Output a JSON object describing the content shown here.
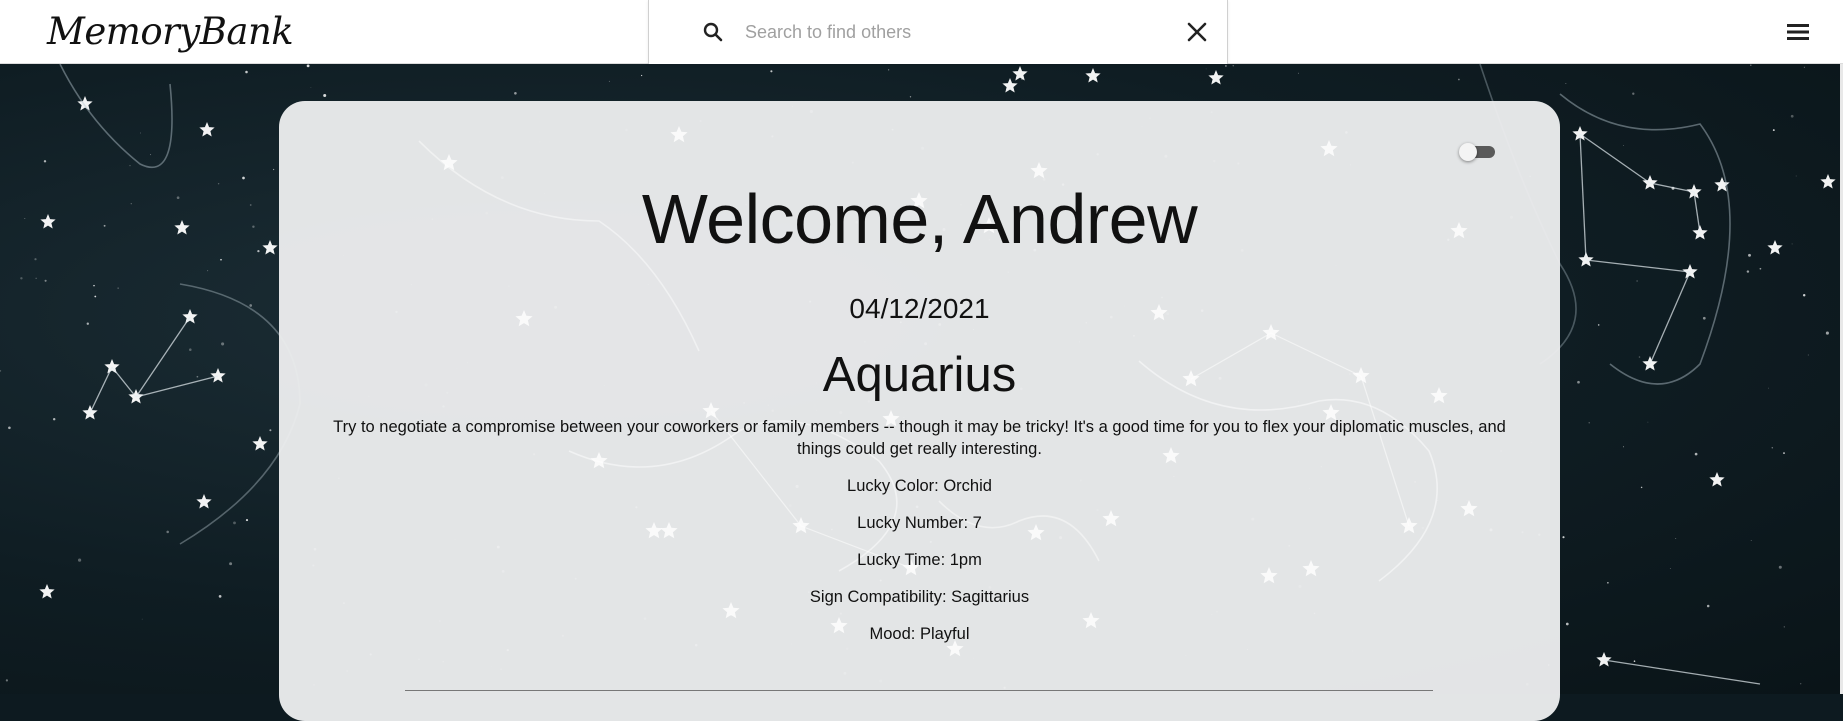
{
  "app": {
    "logo": "MemoryBank"
  },
  "search": {
    "placeholder": "Search to find others",
    "value": ""
  },
  "icons": {
    "search": "search-icon",
    "close": "close-icon",
    "menu": "hamburger-menu-icon"
  },
  "card": {
    "toggle_on": false,
    "welcome": "Welcome, Andrew",
    "date": "04/12/2021",
    "sign": "Aquarius",
    "horoscope": "Try to negotiate a compromise between your coworkers or family members -- though it may be tricky! It's a good time for you to flex your diplomatic muscles, and things could get really interesting.",
    "lucky_color": "Lucky Color: Orchid",
    "lucky_number": "Lucky Number: 7",
    "lucky_time": "Lucky Time: 1pm",
    "compatibility": "Sign Compatibility: Sagittarius",
    "mood": "Mood: Playful"
  },
  "colors": {
    "background": "#0f1d23",
    "card": "#ecedee",
    "text": "#111111"
  }
}
